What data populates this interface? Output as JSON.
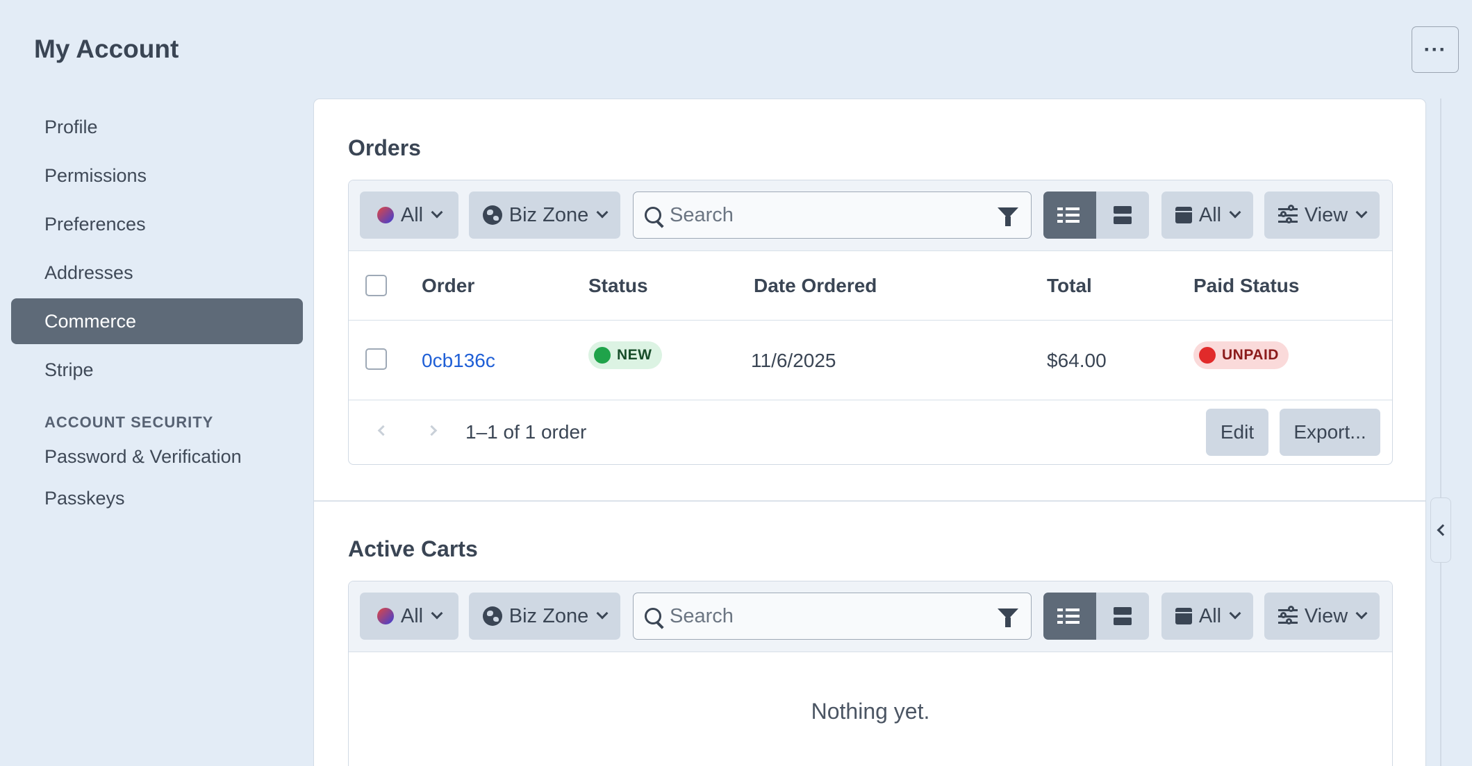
{
  "header": {
    "title": "My Account",
    "more_label": "···"
  },
  "sidebar": {
    "items": [
      {
        "label": "Profile"
      },
      {
        "label": "Permissions"
      },
      {
        "label": "Preferences"
      },
      {
        "label": "Addresses"
      },
      {
        "label": "Commerce",
        "active": true
      },
      {
        "label": "Stripe"
      }
    ],
    "section_title": "ACCOUNT SECURITY",
    "security_items": [
      {
        "label": "Password & Verification"
      },
      {
        "label": "Passkeys"
      }
    ]
  },
  "orders": {
    "title": "Orders",
    "toolbar": {
      "status_filter": "All",
      "zone_filter": "Biz Zone",
      "search_placeholder": "Search",
      "date_filter": "All",
      "view_label": "View"
    },
    "columns": [
      "Order",
      "Status",
      "Date Ordered",
      "Total",
      "Paid Status"
    ],
    "rows": [
      {
        "order": "0cb136c",
        "status": "NEW",
        "date": "11/6/2025",
        "total": "$64.00",
        "paid": "UNPAID"
      }
    ],
    "pagination": "1–1 of 1 order",
    "edit_label": "Edit",
    "export_label": "Export..."
  },
  "carts": {
    "title": "Active Carts",
    "toolbar": {
      "status_filter": "All",
      "zone_filter": "Biz Zone",
      "search_placeholder": "Search",
      "date_filter": "All",
      "view_label": "View"
    },
    "empty_text": "Nothing yet."
  },
  "colors": {
    "background": "#e3ecf6",
    "active_nav": "#5e6a78",
    "link": "#1f5fd6",
    "new_badge": "#1fa34a",
    "unpaid_badge": "#e12a2a"
  },
  "icons": [
    "more-icon",
    "globe-icon",
    "search-icon",
    "filter-icon",
    "list-icon",
    "rows-icon",
    "calendar-icon",
    "sliders-icon",
    "chevron-down-icon",
    "chevron-left-icon"
  ]
}
